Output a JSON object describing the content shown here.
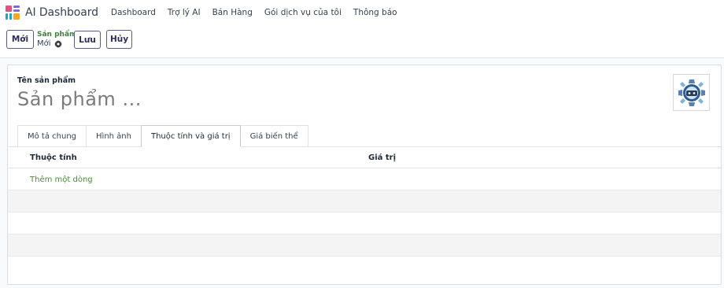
{
  "app": {
    "title": "AI Dashboard",
    "logo_icon": "apps-grid-icon",
    "logo_colors": [
      "#e2527f",
      "#7b6cd4",
      "#21a6c0",
      "#f5a623"
    ]
  },
  "nav": {
    "items": [
      {
        "label": "Dashboard"
      },
      {
        "label": "Trợ lý AI"
      },
      {
        "label": "Bán Hàng"
      },
      {
        "label": "Gói dịch vụ của tôi"
      },
      {
        "label": "Thông báo"
      }
    ]
  },
  "control": {
    "new_label": "Mới",
    "breadcrumb_parent": "Sản phẩm",
    "breadcrumb_current": "Mới",
    "gear_icon": "gear-icon",
    "save_label": "Lưu",
    "discard_label": "Hủy"
  },
  "form": {
    "name_label": "Tên sản phẩm",
    "name_placeholder": "Sản phẩm ...",
    "image_icon": "robot-placeholder-icon",
    "tabs": [
      {
        "label": "Mô tả chung",
        "active": false
      },
      {
        "label": "Hình ảnh",
        "active": false
      },
      {
        "label": "Thuộc tính và giá trị",
        "active": true
      },
      {
        "label": "Giá biến thể",
        "active": false
      }
    ],
    "table": {
      "columns": [
        "Thuộc tính",
        "Giá trị"
      ],
      "add_line_label": "Thêm một dòng"
    }
  },
  "colors": {
    "accent": "#5b5b8a",
    "link_green": "#4f8a3c",
    "breadcrumb_green": "#3f7f3f"
  }
}
